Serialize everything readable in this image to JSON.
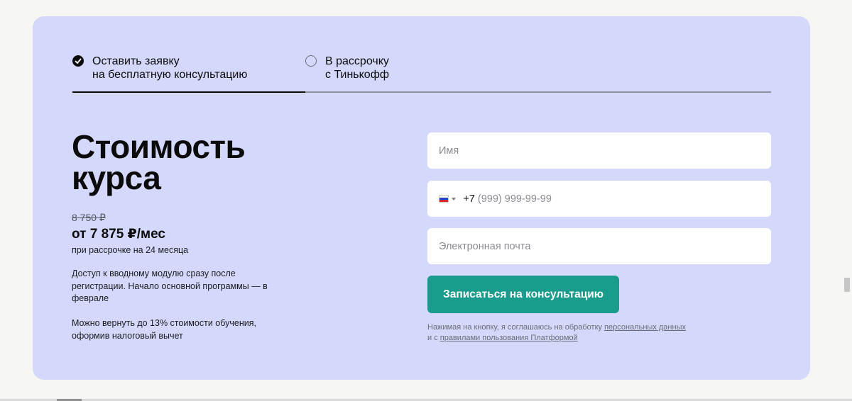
{
  "tabs": [
    {
      "label": "Оставить заявку\nна бесплатную консультацию",
      "selected": true
    },
    {
      "label": "В рассрочку\nс Тинькофф",
      "selected": false
    }
  ],
  "course": {
    "title": "Стоимость\nкурса",
    "old_price": "8 750 ₽",
    "price": "от 7 875 ₽/мес",
    "price_note": "при рассрочке на 24 месяца",
    "info_1": "Доступ к вводному модулю сразу после регистрации. Начало основной программы — в феврале",
    "info_2": "Можно вернуть до 13% стоимости обучения, оформив налоговый вычет"
  },
  "form": {
    "name_placeholder": "Имя",
    "phone_code": "+7",
    "phone_placeholder": "(999) 999-99-99",
    "email_placeholder": "Электронная почта",
    "submit_label": "Записаться на консультацию",
    "consent_text_1": "Нажимая на кнопку, я соглашаюсь на обработку ",
    "consent_link_1": "персональных данных",
    "consent_text_2": " и с ",
    "consent_link_2": "правилами пользования Платформой"
  },
  "icons": {
    "check": "check-circle-icon",
    "radio": "radio-empty-icon",
    "flag": "russia-flag-icon"
  },
  "colors": {
    "card_bg": "#d4d9fb",
    "button": "#1a9c8c",
    "flag": [
      "#ffffff",
      "#1f46c8",
      "#d8252f"
    ]
  }
}
